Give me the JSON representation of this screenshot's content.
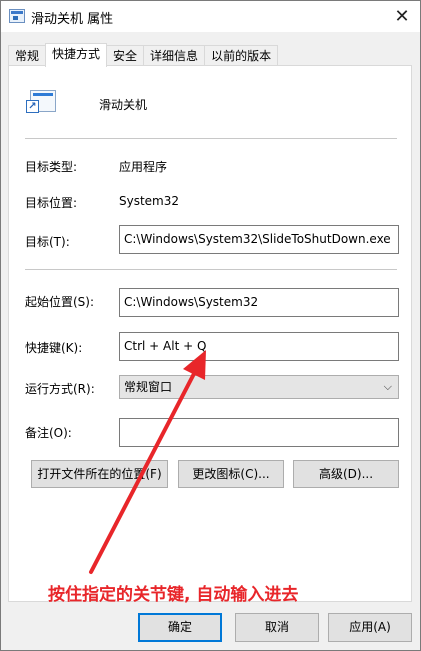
{
  "window": {
    "title": "滑动关机 属性",
    "close": "✕"
  },
  "tabs": [
    {
      "label": "常规"
    },
    {
      "label": "快捷方式",
      "active": true
    },
    {
      "label": "安全"
    },
    {
      "label": "详细信息"
    },
    {
      "label": "以前的版本"
    }
  ],
  "shortcut": {
    "app_name": "滑动关机",
    "target_type_label": "目标类型:",
    "target_type_value": "应用程序",
    "target_location_label": "目标位置:",
    "target_location_value": "System32",
    "target_label": "目标(T):",
    "target_value": "C:\\Windows\\System32\\SlideToShutDown.exe",
    "start_in_label": "起始位置(S):",
    "start_in_value": "C:\\Windows\\System32",
    "hotkey_label": "快捷键(K):",
    "hotkey_value": "Ctrl + Alt + Q",
    "run_label": "运行方式(R):",
    "run_value": "常规窗口",
    "comment_label": "备注(O):",
    "comment_value": "",
    "open_location_button": "打开文件所在的位置(F)",
    "change_icon_button": "更改图标(C)...",
    "advanced_button": "高级(D)..."
  },
  "annotation": {
    "text": "按住指定的关节键, 自动输入进去",
    "color": "#e8262a"
  },
  "footer": {
    "ok": "确定",
    "cancel": "取消",
    "apply": "应用(A)"
  },
  "colors": {
    "accent": "#0078d7",
    "background": "#f0f0f0",
    "annotation": "#e8262a"
  }
}
